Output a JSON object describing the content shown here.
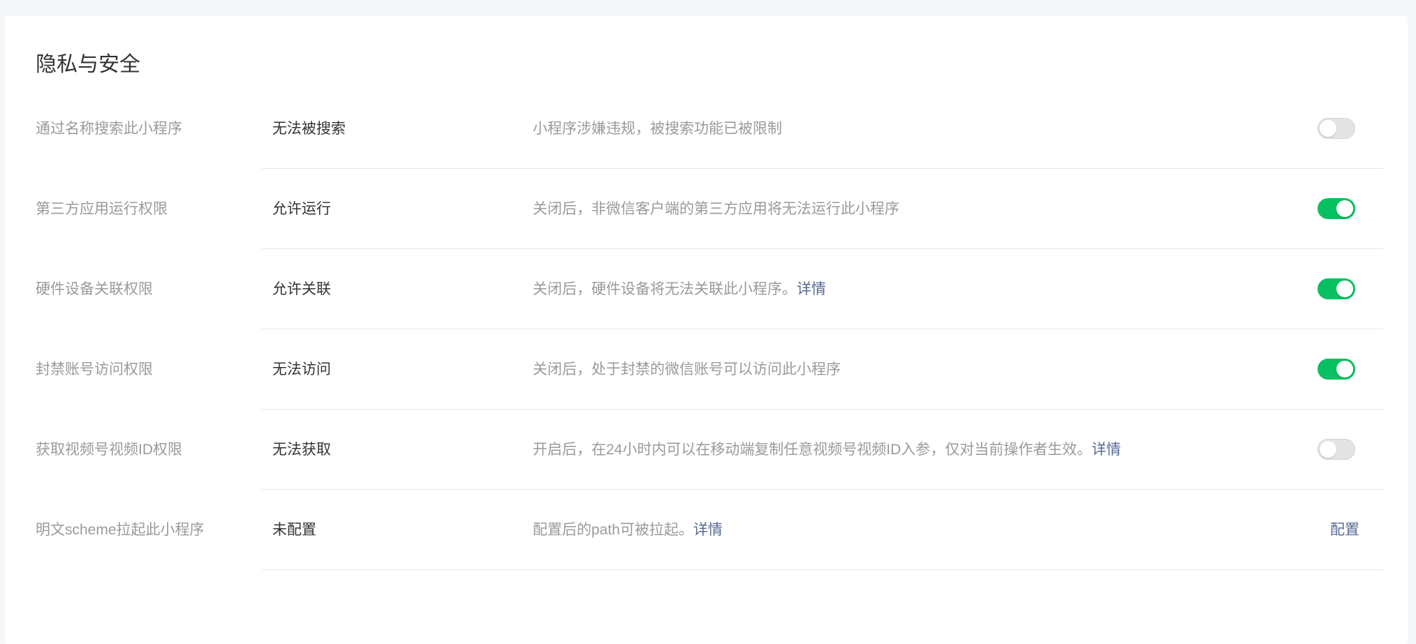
{
  "page": {
    "title": "隐私与安全"
  },
  "colors": {
    "accent_green": "#07c160",
    "link_blue": "#576b95",
    "label_gray": "#9a9a9a",
    "text_dark": "#333333"
  },
  "rows": [
    {
      "label": "通过名称搜索此小程序",
      "status": "无法被搜索",
      "desc": "小程序涉嫌违规，被搜索功能已被限制",
      "link": "",
      "control": "toggle",
      "toggle_on": false
    },
    {
      "label": "第三方应用运行权限",
      "status": "允许运行",
      "desc": "关闭后，非微信客户端的第三方应用将无法运行此小程序",
      "link": "",
      "control": "toggle",
      "toggle_on": true
    },
    {
      "label": "硬件设备关联权限",
      "status": "允许关联",
      "desc": "关闭后，硬件设备将无法关联此小程序。",
      "link": "详情",
      "control": "toggle",
      "toggle_on": true
    },
    {
      "label": "封禁账号访问权限",
      "status": "无法访问",
      "desc": "关闭后，处于封禁的微信账号可以访问此小程序",
      "link": "",
      "control": "toggle",
      "toggle_on": true
    },
    {
      "label": "获取视频号视频ID权限",
      "status": "无法获取",
      "desc": "开启后，在24小时内可以在移动端复制任意视频号视频ID入参，仅对当前操作者生效。",
      "link": "详情",
      "control": "toggle",
      "toggle_on": false
    },
    {
      "label": "明文scheme拉起此小程序",
      "status": "未配置",
      "desc": "配置后的path可被拉起。",
      "link": "详情",
      "control": "link",
      "action_label": "配置"
    }
  ]
}
